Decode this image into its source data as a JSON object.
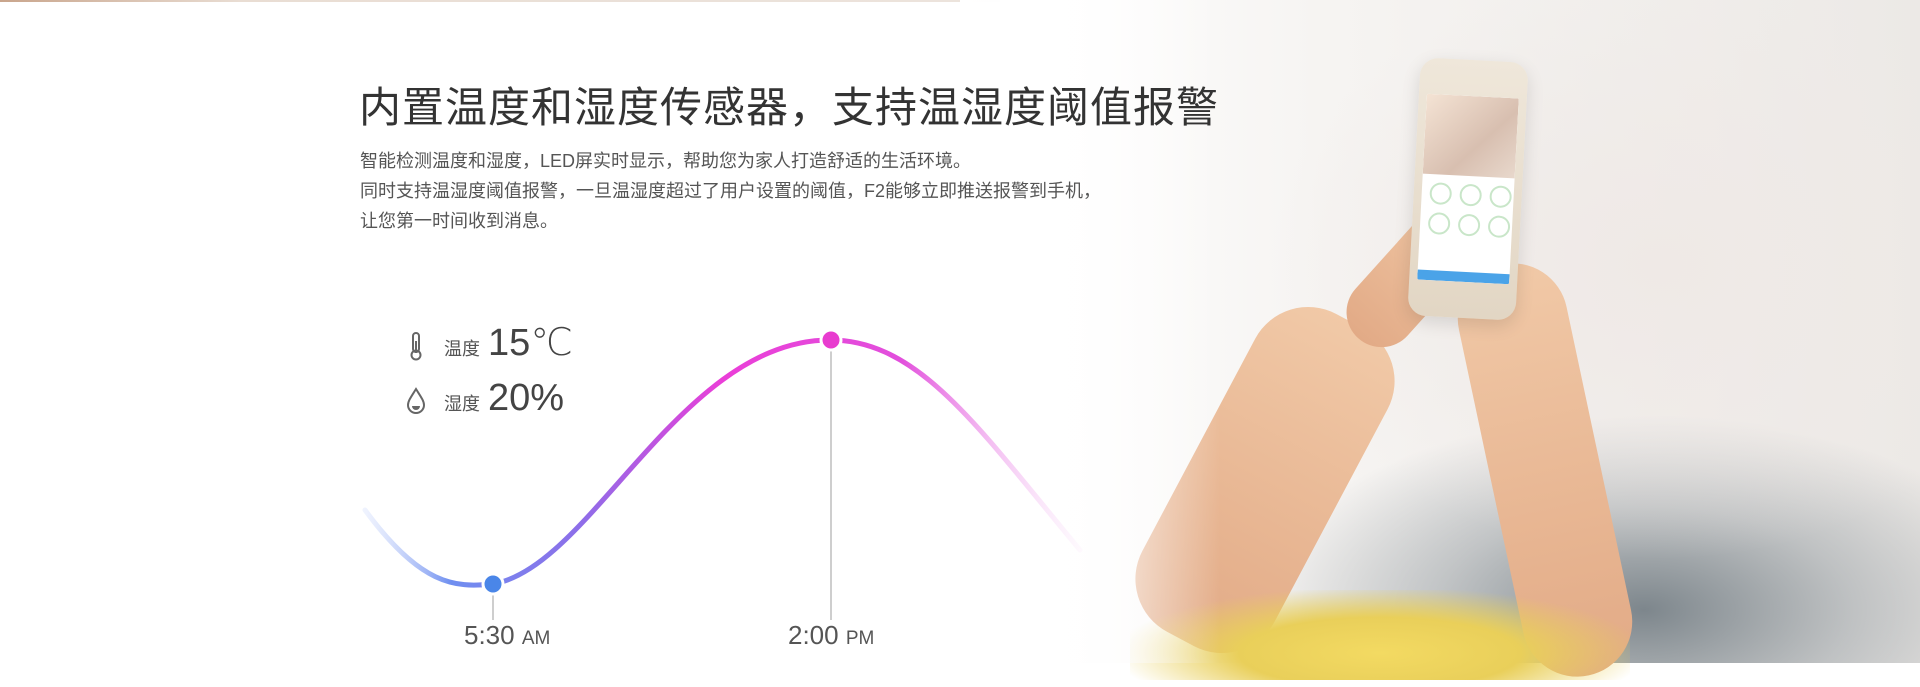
{
  "headline": "内置温度和湿度传感器，支持温湿度阈值报警",
  "description": [
    "智能检测温度和湿度，LED屏实时显示，帮助您为家人打造舒适的生活环境。",
    "同时支持温湿度阈值报警，一旦温湿度超过了用户设置的阈值，F2能够立即推送报警到手机，",
    "让您第一时间收到消息。"
  ],
  "readings": {
    "temperature": {
      "icon": "thermometer-icon",
      "label": "温度",
      "value": "15℃"
    },
    "humidity": {
      "icon": "water-drop-icon",
      "label": "湿度",
      "value": "20%"
    }
  },
  "timeline": {
    "low": {
      "time": "5:30",
      "ampm": "AM",
      "color": "#4a86e8"
    },
    "high": {
      "time": "2:00",
      "ampm": "PM",
      "color": "#e83ccf"
    }
  },
  "colors": {
    "curve_start": "#7b9cf0",
    "curve_mid": "#b15ee6",
    "curve_peak": "#ee3ed8"
  }
}
